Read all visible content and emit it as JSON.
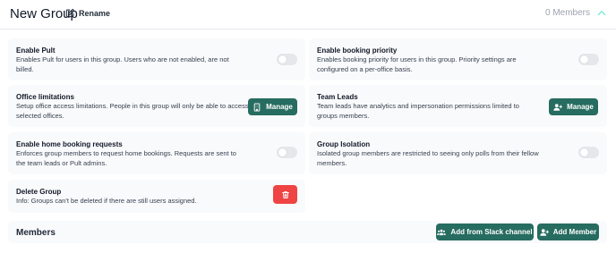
{
  "header": {
    "title": "New Group",
    "rename_label": "Rename",
    "members_count": "0 Members"
  },
  "settings": {
    "enable_pult": {
      "title": "Enable Pult",
      "description": "Enables Pult for users in this group. Users who are not enabled, are not billed.",
      "enabled": false
    },
    "enable_booking_priority": {
      "title": "Enable booking priority",
      "description": "Enables booking priority for users in this group. Priority settings are configured on a per-office basis.",
      "enabled": false
    },
    "office_limitations": {
      "title": "Office limitations",
      "description": "Setup office access limitations. People in this group will only be able to access selected offices.",
      "button_label": "Manage"
    },
    "team_leads": {
      "title": "Team Leads",
      "description": "Team leads have analytics and impersonation permissions limited to groups members.",
      "button_label": "Manage"
    },
    "home_booking_requests": {
      "title": "Enable home booking requests",
      "description": "Enforces group members to request home bookings. Requests are sent to the team leads or Pult admins.",
      "enabled": false
    },
    "group_isolation": {
      "title": "Group Isolation",
      "description": "Isolated group members are restricted to seeing only polls from their fellow members.",
      "enabled": false
    },
    "delete_group": {
      "title": "Delete Group",
      "description": "Info: Groups can't be deleted if there are still users assigned."
    }
  },
  "members": {
    "title": "Members",
    "add_from_slack_label": "Add from Slack channel",
    "add_member_label": "Add Member"
  },
  "colors": {
    "accent": "#276c60",
    "danger": "#ef4444",
    "card_background": "#f9fafb",
    "muted_text": "#9ca3af",
    "collapse_chevron": "#5eead4"
  },
  "icons": {
    "rename": "edit-icon",
    "collapse": "chevron-up-icon",
    "office_manage": "building-icon",
    "team_leads_manage": "user-plus-icon",
    "delete": "trash-icon",
    "add_from_slack": "users-icon",
    "add_member": "user-plus-icon"
  }
}
